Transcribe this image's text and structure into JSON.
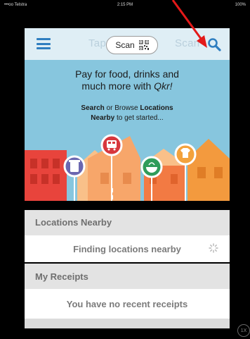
{
  "status_bar": {
    "carrier": "•••oo Telstra ",
    "time": "2:15 PM",
    "battery": "100%"
  },
  "nav": {
    "menu_icon": "hamburger-menu-icon",
    "ghost_title_left": "Tap",
    "ghost_title_right": "Scan",
    "scan_label": "Scan",
    "qr_icon": "qr-code-icon",
    "search_icon": "search-icon"
  },
  "hero": {
    "line1": "Pay for food, drinks and",
    "line2_prefix": "much more with ",
    "line2_brand": "Qkr!",
    "sub1_a": "Search",
    "sub1_b": " or Browse ",
    "sub1_c": "Locations",
    "sub2_a": "Nearby",
    "sub2_b": " to get started..."
  },
  "locations": {
    "header": "Locations Nearby",
    "status": "Finding locations nearby"
  },
  "receipts": {
    "header": "My Receipts",
    "empty": "You have no recent receipts"
  },
  "zoom": {
    "label": "1X"
  },
  "colors": {
    "accent": "#2f7ec0",
    "hero_bg": "#87c6de",
    "arrow": "#e31919"
  }
}
